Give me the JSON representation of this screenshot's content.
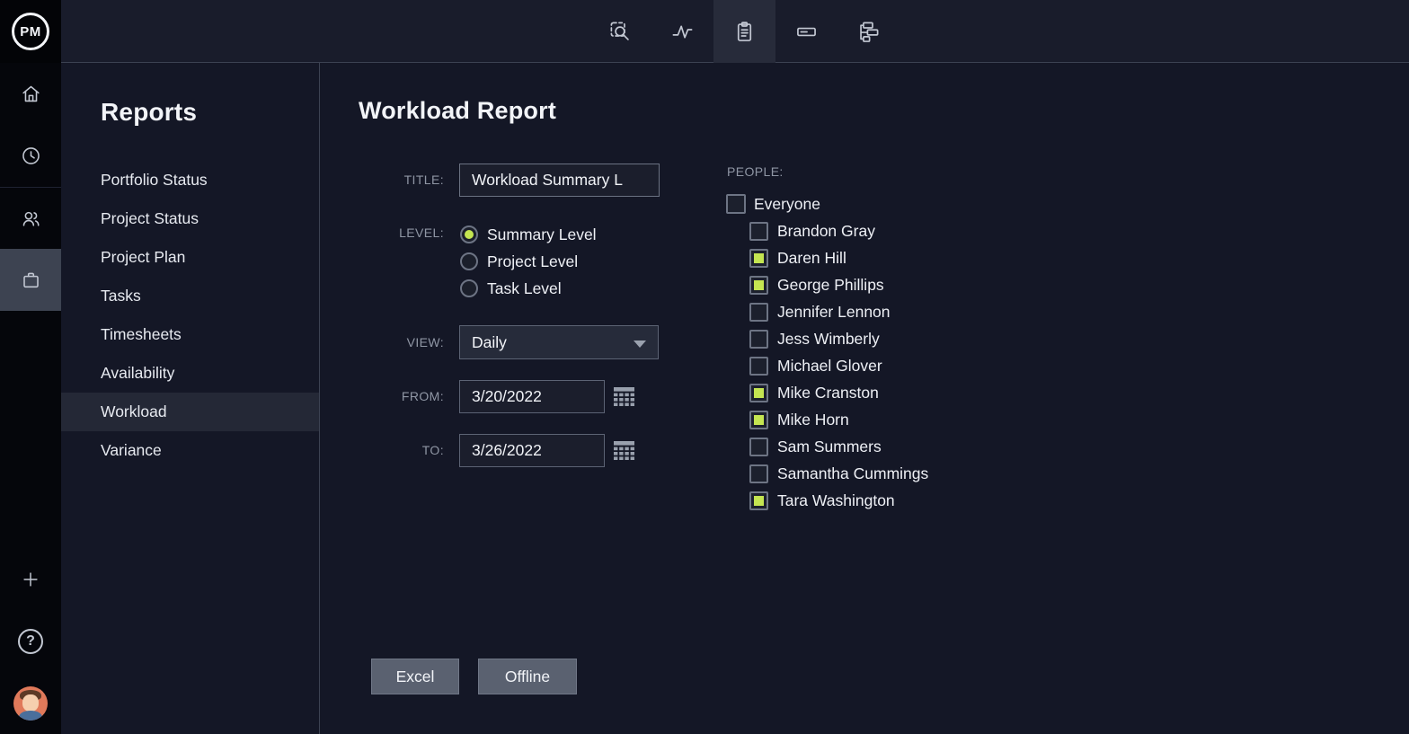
{
  "app": {
    "logo": "PM"
  },
  "topbar": {
    "tabs": [
      {
        "icon": "search-select-icon",
        "active": false
      },
      {
        "icon": "activity-icon",
        "active": false
      },
      {
        "icon": "report-clipboard-icon",
        "active": true
      },
      {
        "icon": "task-bar-icon",
        "active": false
      },
      {
        "icon": "gantt-icon",
        "active": false
      }
    ]
  },
  "rail": {
    "items": [
      {
        "icon": "home-icon",
        "active": false
      },
      {
        "icon": "clock-icon",
        "active": false
      },
      {
        "icon": "team-icon",
        "active": false
      },
      {
        "icon": "briefcase-icon",
        "active": true
      }
    ],
    "help_glyph": "?"
  },
  "reports_panel": {
    "title": "Reports",
    "items": [
      {
        "label": "Portfolio Status",
        "active": false
      },
      {
        "label": "Project Status",
        "active": false
      },
      {
        "label": "Project Plan",
        "active": false
      },
      {
        "label": "Tasks",
        "active": false
      },
      {
        "label": "Timesheets",
        "active": false
      },
      {
        "label": "Availability",
        "active": false
      },
      {
        "label": "Workload",
        "active": true
      },
      {
        "label": "Variance",
        "active": false
      }
    ]
  },
  "main": {
    "title": "Workload Report",
    "form": {
      "title_label": "TITLE:",
      "title_value": "Workload Summary L",
      "level_label": "LEVEL:",
      "levels": [
        {
          "label": "Summary Level",
          "selected": true
        },
        {
          "label": "Project Level",
          "selected": false
        },
        {
          "label": "Task Level",
          "selected": false
        }
      ],
      "view_label": "VIEW:",
      "view_value": "Daily",
      "from_label": "FROM:",
      "from_value": "3/20/2022",
      "to_label": "TO:",
      "to_value": "3/26/2022"
    },
    "people": {
      "label": "PEOPLE:",
      "everyone": {
        "label": "Everyone",
        "checked": false
      },
      "members": [
        {
          "name": "Brandon Gray",
          "checked": false
        },
        {
          "name": "Daren Hill",
          "checked": true
        },
        {
          "name": "George Phillips",
          "checked": true
        },
        {
          "name": "Jennifer Lennon",
          "checked": false
        },
        {
          "name": "Jess Wimberly",
          "checked": false
        },
        {
          "name": "Michael Glover",
          "checked": false
        },
        {
          "name": "Mike Cranston",
          "checked": true
        },
        {
          "name": "Mike Horn",
          "checked": true
        },
        {
          "name": "Sam Summers",
          "checked": false
        },
        {
          "name": "Samantha Cummings",
          "checked": false
        },
        {
          "name": "Tara Washington",
          "checked": true
        }
      ]
    },
    "export_buttons": [
      {
        "label": "Excel"
      },
      {
        "label": "Offline"
      }
    ]
  },
  "colors": {
    "accent_green": "#c4e551",
    "topbar_active_bg": "#272b3a",
    "rail_active_bg": "#3d4351",
    "selected_row_bg": "#242836"
  }
}
